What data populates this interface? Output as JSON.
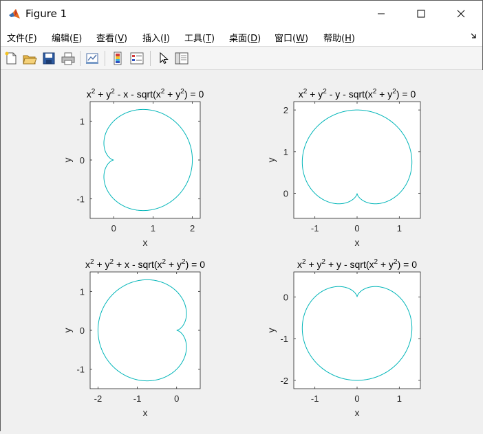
{
  "window": {
    "title": "Figure 1",
    "controls": {
      "minimize": "—",
      "maximize": "☐",
      "close": "✕"
    }
  },
  "menu": [
    {
      "label": "文件(",
      "key": "F",
      "suffix": ")"
    },
    {
      "label": "编辑(",
      "key": "E",
      "suffix": ")"
    },
    {
      "label": "查看(",
      "key": "V",
      "suffix": ")"
    },
    {
      "label": "插入(",
      "key": "I",
      "suffix": ")"
    },
    {
      "label": "工具(",
      "key": "T",
      "suffix": ")"
    },
    {
      "label": "桌面(",
      "key": "D",
      "suffix": ")"
    },
    {
      "label": "窗口(",
      "key": "W",
      "suffix": ")"
    },
    {
      "label": "帮助(",
      "key": "H",
      "suffix": ")"
    }
  ],
  "toolbar": {
    "icons": [
      "new-figure-icon",
      "open-file-icon",
      "save-icon",
      "print-icon",
      "link-plot-icon",
      "colorbar-icon",
      "legend-icon",
      "pointer-icon",
      "plot-tools-icon"
    ]
  },
  "colors": {
    "curve": "#00b5b8",
    "axes": "#262626"
  },
  "chart_data": [
    {
      "type": "line",
      "title": "x² + y² - x - sqrt(x² + y²) = 0",
      "title_parts": [
        "x",
        "2",
        " + y",
        "2",
        " - x - sqrt(x",
        "2",
        " + y",
        "2",
        ") = 0"
      ],
      "equation": "r = 1 + cos θ",
      "xlabel": "x",
      "ylabel": "y",
      "xlim": [
        -0.6,
        2.2
      ],
      "ylim": [
        -1.5,
        1.5
      ],
      "xticks": [
        "0",
        "1",
        "2"
      ],
      "xtick_values": [
        0,
        1,
        2
      ],
      "yticks": [
        "-1",
        "0",
        "1"
      ],
      "ytick_values": [
        -1,
        0,
        1
      ]
    },
    {
      "type": "line",
      "title": "x² + y² - y - sqrt(x² + y²) = 0",
      "title_parts": [
        "x",
        "2",
        " + y",
        "2",
        " - y - sqrt(x",
        "2",
        " + y",
        "2",
        ") = 0"
      ],
      "equation": "r = 1 + sin θ",
      "xlabel": "x",
      "ylabel": "y",
      "xlim": [
        -1.5,
        1.5
      ],
      "ylim": [
        -0.6,
        2.2
      ],
      "xticks": [
        "-1",
        "0",
        "1"
      ],
      "xtick_values": [
        -1,
        0,
        1
      ],
      "yticks": [
        "0",
        "1",
        "2"
      ],
      "ytick_values": [
        0,
        1,
        2
      ]
    },
    {
      "type": "line",
      "title": "x² + y² + x - sqrt(x² + y²) = 0",
      "title_parts": [
        "x",
        "2",
        " + y",
        "2",
        " + x - sqrt(x",
        "2",
        " + y",
        "2",
        ") = 0"
      ],
      "equation": "r = 1 - cos θ",
      "xlabel": "x",
      "ylabel": "y",
      "xlim": [
        -2.2,
        0.6
      ],
      "ylim": [
        -1.5,
        1.5
      ],
      "xticks": [
        "-2",
        "-1",
        "0"
      ],
      "xtick_values": [
        -2,
        -1,
        0
      ],
      "yticks": [
        "-1",
        "0",
        "1"
      ],
      "ytick_values": [
        -1,
        0,
        1
      ]
    },
    {
      "type": "line",
      "title": "x² + y² + y - sqrt(x² + y²) = 0",
      "title_parts": [
        "x",
        "2",
        " + y",
        "2",
        " + y - sqrt(x",
        "2",
        " + y",
        "2",
        ") = 0"
      ],
      "equation": "r = 1 - sin θ",
      "xlabel": "x",
      "ylabel": "y",
      "xlim": [
        -1.5,
        1.5
      ],
      "ylim": [
        -2.2,
        0.6
      ],
      "xticks": [
        "-1",
        "0",
        "1"
      ],
      "xtick_values": [
        -1,
        0,
        1
      ],
      "yticks": [
        "-2",
        "-1",
        "0"
      ],
      "ytick_values": [
        -2,
        -1,
        0
      ]
    }
  ]
}
